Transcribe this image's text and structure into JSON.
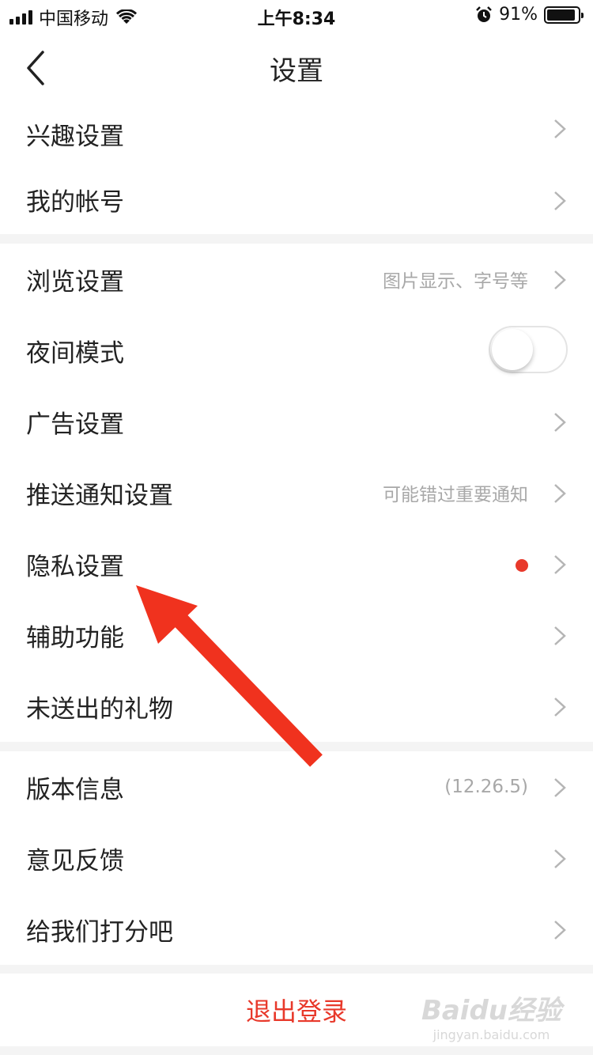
{
  "status_bar": {
    "carrier": "中国移动",
    "time": "上午8:34",
    "battery": "91%",
    "battery_level": 0.91
  },
  "nav": {
    "title": "设置",
    "back_icon": "chevron-left-icon"
  },
  "groups": [
    {
      "rows": [
        {
          "label": "兴趣设置"
        },
        {
          "label": "我的帐号"
        }
      ]
    },
    {
      "rows": [
        {
          "label": "浏览设置",
          "hint": "图片显示、字号等"
        },
        {
          "label": "夜间模式",
          "toggle": false
        },
        {
          "label": "广告设置"
        },
        {
          "label": "推送通知设置",
          "hint": "可能错过重要通知"
        },
        {
          "label": "隐私设置",
          "badge": "red-dot"
        },
        {
          "label": "辅助功能"
        },
        {
          "label": "未送出的礼物"
        }
      ]
    },
    {
      "rows": [
        {
          "label": "版本信息",
          "hint": "(12.26.5)"
        },
        {
          "label": "意见反馈"
        },
        {
          "label": "给我们打分吧"
        }
      ]
    }
  ],
  "logout_label": "退出登录",
  "watermark": {
    "main": "Baidu经验",
    "sub": "jingyan.baidu.com"
  },
  "colors": {
    "accent": "#e8392b",
    "hint": "#a8a8a8",
    "background": "#f4f4f4"
  }
}
